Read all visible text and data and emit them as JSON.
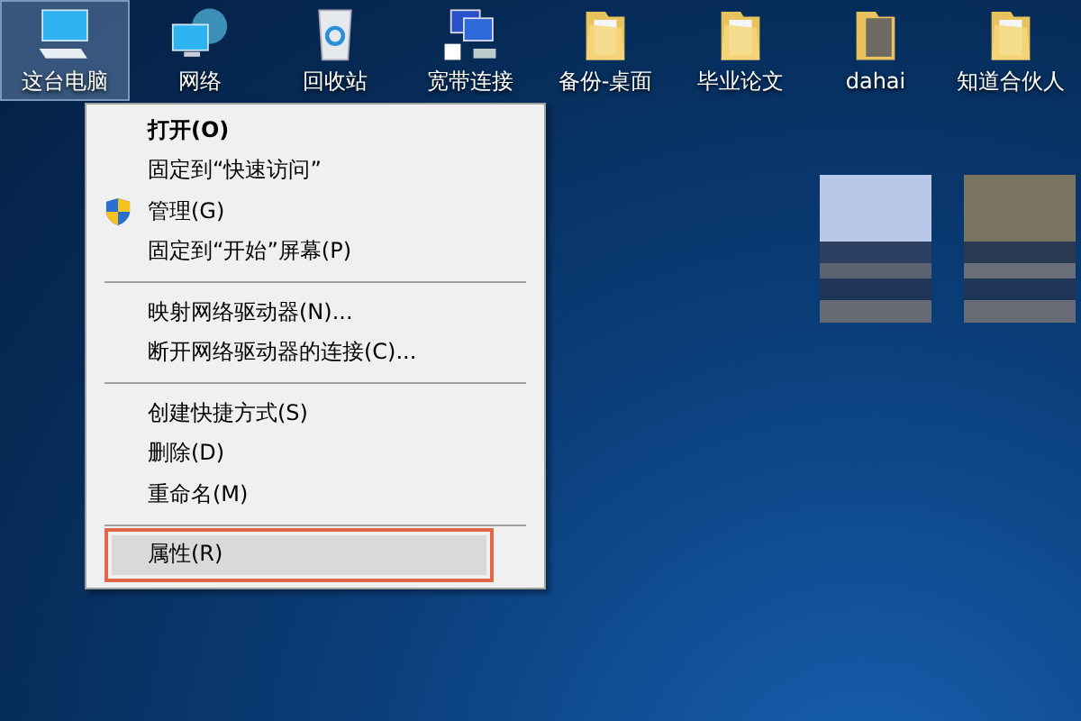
{
  "desktop_icons": [
    {
      "label": "这台电脑",
      "kind": "computer",
      "selected": true
    },
    {
      "label": "网络",
      "kind": "network",
      "selected": false
    },
    {
      "label": "回收站",
      "kind": "recycle",
      "selected": false
    },
    {
      "label": "宽带连接",
      "kind": "broadband",
      "selected": false
    },
    {
      "label": "备份-桌面",
      "kind": "folder",
      "selected": false
    },
    {
      "label": "毕业论文",
      "kind": "folder",
      "selected": false
    },
    {
      "label": "dahai",
      "kind": "photo-folder",
      "selected": false
    },
    {
      "label": "知道合伙人",
      "kind": "folder",
      "selected": false
    }
  ],
  "context_menu": {
    "items": [
      {
        "kind": "item",
        "label": "打开(O)",
        "bold": true,
        "shield": false,
        "selected": false
      },
      {
        "kind": "item",
        "label": "固定到“快速访问”",
        "bold": false,
        "shield": false,
        "selected": false
      },
      {
        "kind": "item",
        "label": "管理(G)",
        "bold": false,
        "shield": true,
        "selected": false
      },
      {
        "kind": "item",
        "label": "固定到“开始”屏幕(P)",
        "bold": false,
        "shield": false,
        "selected": false
      },
      {
        "kind": "separator"
      },
      {
        "kind": "item",
        "label": "映射网络驱动器(N)...",
        "bold": false,
        "shield": false,
        "selected": false
      },
      {
        "kind": "item",
        "label": "断开网络驱动器的连接(C)...",
        "bold": false,
        "shield": false,
        "selected": false
      },
      {
        "kind": "separator"
      },
      {
        "kind": "item",
        "label": "创建快捷方式(S)",
        "bold": false,
        "shield": false,
        "selected": false
      },
      {
        "kind": "item",
        "label": "删除(D)",
        "bold": false,
        "shield": false,
        "selected": false
      },
      {
        "kind": "item",
        "label": "重命名(M)",
        "bold": false,
        "shield": false,
        "selected": false
      },
      {
        "kind": "separator"
      },
      {
        "kind": "item",
        "label": "属性(R)",
        "bold": false,
        "shield": false,
        "selected": true
      }
    ]
  }
}
